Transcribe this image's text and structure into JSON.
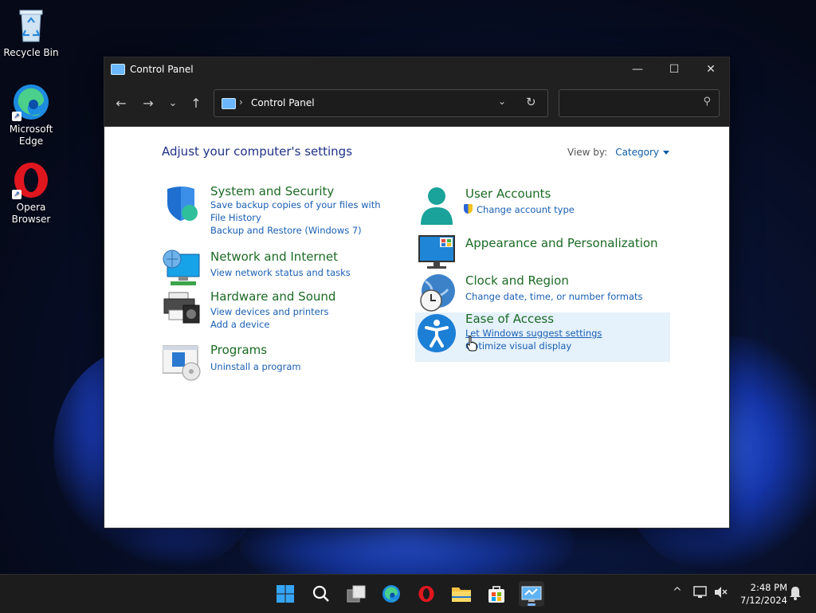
{
  "desktop": {
    "icons": [
      {
        "label": "Recycle Bin"
      },
      {
        "label": "Microsoft Edge"
      },
      {
        "label": "Opera Browser"
      }
    ]
  },
  "window": {
    "title": "Control Panel",
    "controls": {
      "minimize": "—",
      "maximize": "☐",
      "close": "✕"
    },
    "nav": {
      "back": "←",
      "forward": "→",
      "recent": "⌄",
      "up": "↑"
    },
    "address": {
      "separator": "›",
      "crumb": "Control Panel",
      "dropdown": "⌄",
      "refresh": "↻"
    },
    "search": {
      "value": "",
      "placeholder": ""
    }
  },
  "content": {
    "heading": "Adjust your computer's settings",
    "view_by_label": "View by:",
    "view_by_value": "Category",
    "categories_left": [
      {
        "title": "System and Security",
        "links": [
          "Save backup copies of your files with File History",
          "Backup and Restore (Windows 7)"
        ]
      },
      {
        "title": "Network and Internet",
        "links": [
          "View network status and tasks"
        ]
      },
      {
        "title": "Hardware and Sound",
        "links": [
          "View devices and printers",
          "Add a device"
        ]
      },
      {
        "title": "Programs",
        "links": [
          "Uninstall a program"
        ]
      }
    ],
    "categories_right": [
      {
        "title": "User Accounts",
        "links": [
          "Change account type"
        ]
      },
      {
        "title": "Appearance and Personalization",
        "links": []
      },
      {
        "title": "Clock and Region",
        "links": [
          "Change date, time, or number formats"
        ]
      },
      {
        "title": "Ease of Access",
        "links": [
          "Let Windows suggest settings",
          "Optimize visual display"
        ]
      }
    ]
  },
  "taskbar": {
    "clock_time": "2:48 PM",
    "clock_date": "7/12/2024",
    "tray_chevron": "^"
  },
  "colors": {
    "accent": "#1a5fb4",
    "category_title": "#1b6a24",
    "heading": "#1e3287",
    "hover_bg": "#e5f1fb"
  }
}
